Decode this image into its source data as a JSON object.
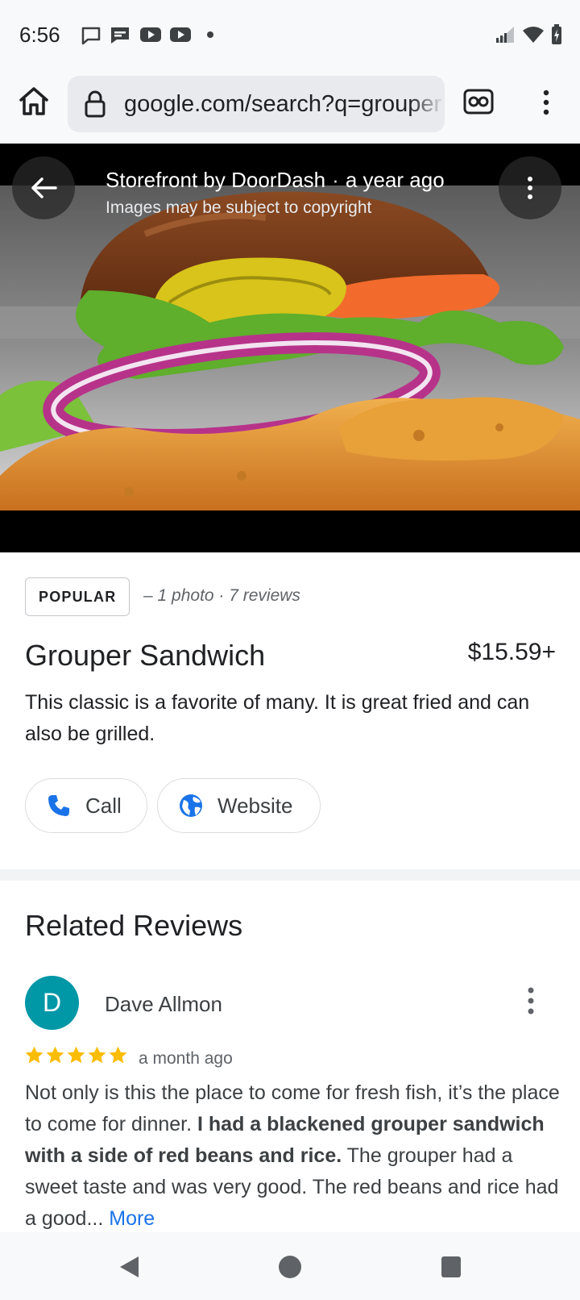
{
  "status_bar": {
    "time": "6:56"
  },
  "browser": {
    "url": "google.com/search?q=grouper"
  },
  "image_viewer": {
    "source": "Storefront by DoorDash",
    "separator": "·",
    "age": "a year ago",
    "copyright_notice": "Images may be subject to copyright"
  },
  "item": {
    "badge": "POPULAR",
    "meta": "– 1 photo · 7 reviews",
    "title": "Grouper Sandwich",
    "price": "$15.59+",
    "description": "This classic is a favorite of many. It is great fried and can also be grilled.",
    "call_label": "Call",
    "website_label": "Website"
  },
  "reviews": {
    "section_title": "Related Reviews",
    "items": [
      {
        "avatar_letter": "D",
        "author": "Dave Allmon",
        "rating": 5,
        "time": "a month ago",
        "text_before": "Not only is this the place to come for fresh fish, it’s the place to come for dinner. ",
        "text_bold": "I had a blackened grouper sandwich with a side of red beans and rice.",
        "text_after": " The grouper had a sweet taste and was very good. The red beans and rice had a good... ",
        "more_label": "More"
      }
    ]
  },
  "colors": {
    "accent_blue": "#1a73e8",
    "star_gold": "#fbbc04",
    "avatar_teal": "#0097a7"
  },
  "icons": [
    "home-icon",
    "lock-icon",
    "incognito-tab-icon",
    "more-vert-icon",
    "back-arrow-icon",
    "phone-icon",
    "globe-icon",
    "star-icon",
    "nav-back-icon",
    "nav-home-icon",
    "nav-recents-icon"
  ]
}
